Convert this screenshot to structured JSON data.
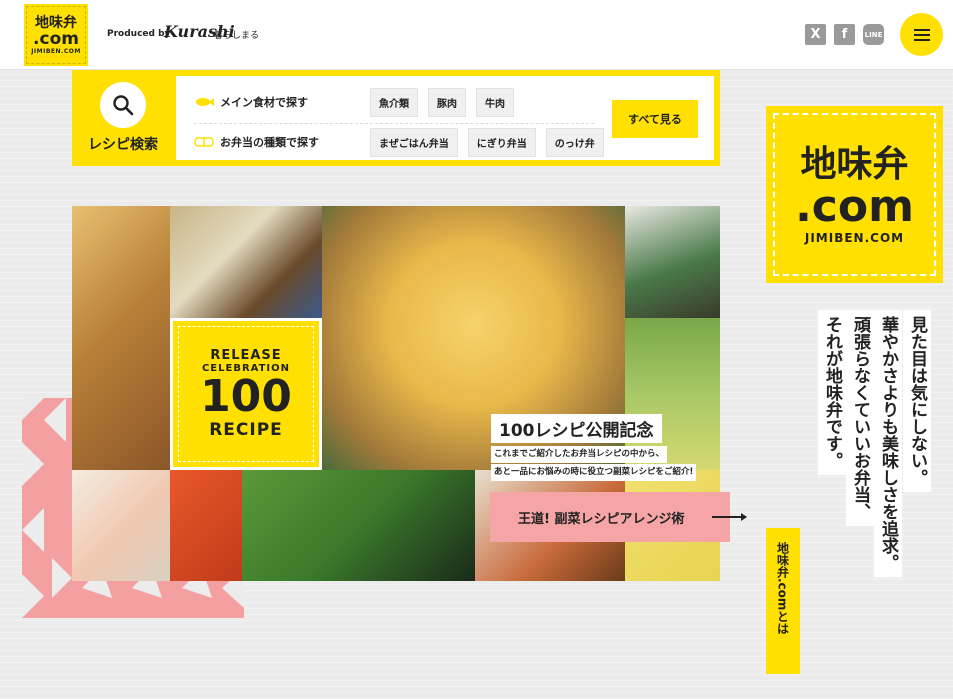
{
  "header": {
    "logo": {
      "line1": "地味弁",
      "line2": ".com",
      "line3": "JIMIBEN.COM"
    },
    "produced_by": "Produced by",
    "brand": "Kurashi",
    "brand_sub": "暮らしまる",
    "social": [
      {
        "name": "x",
        "glyph": "X"
      },
      {
        "name": "facebook",
        "glyph": "f"
      },
      {
        "name": "line",
        "glyph": "LINE"
      }
    ]
  },
  "search": {
    "label": "レシピ検索",
    "rows": [
      {
        "label": "メイン食材で探す",
        "chips": [
          "魚介類",
          "豚肉",
          "牛肉"
        ]
      },
      {
        "label": "お弁当の種類で探す",
        "chips": [
          "まぜごはん弁当",
          "にぎり弁当",
          "のっけ弁"
        ]
      }
    ],
    "see_all": "すべて見る"
  },
  "hero": {
    "badge": {
      "line1": "RELEASE",
      "line2": "CELEBRATION",
      "line3": "100",
      "line4": "RECIPE"
    },
    "title": "100レシピ公開記念",
    "desc1": "これまでご紹介したお弁当レシピの中から、",
    "desc2": "あと一品にお悩みの時に役立つ副菜レシピをご紹介!",
    "cta": "王道! 副菜レシピアレンジ術"
  },
  "side": {
    "logo": {
      "line1": "地味弁",
      "line2": ".com",
      "line3": "JIMIBEN.COM"
    },
    "tagline": [
      "見た目は気にしない。",
      "華やかさよりも美味しさを追求。",
      "頑張らなくていいお弁当、",
      "それが地味弁です。"
    ],
    "about": "地味弁.comとは"
  },
  "colors": {
    "accent": "#ffe000",
    "pink": "#f5a5a5"
  }
}
